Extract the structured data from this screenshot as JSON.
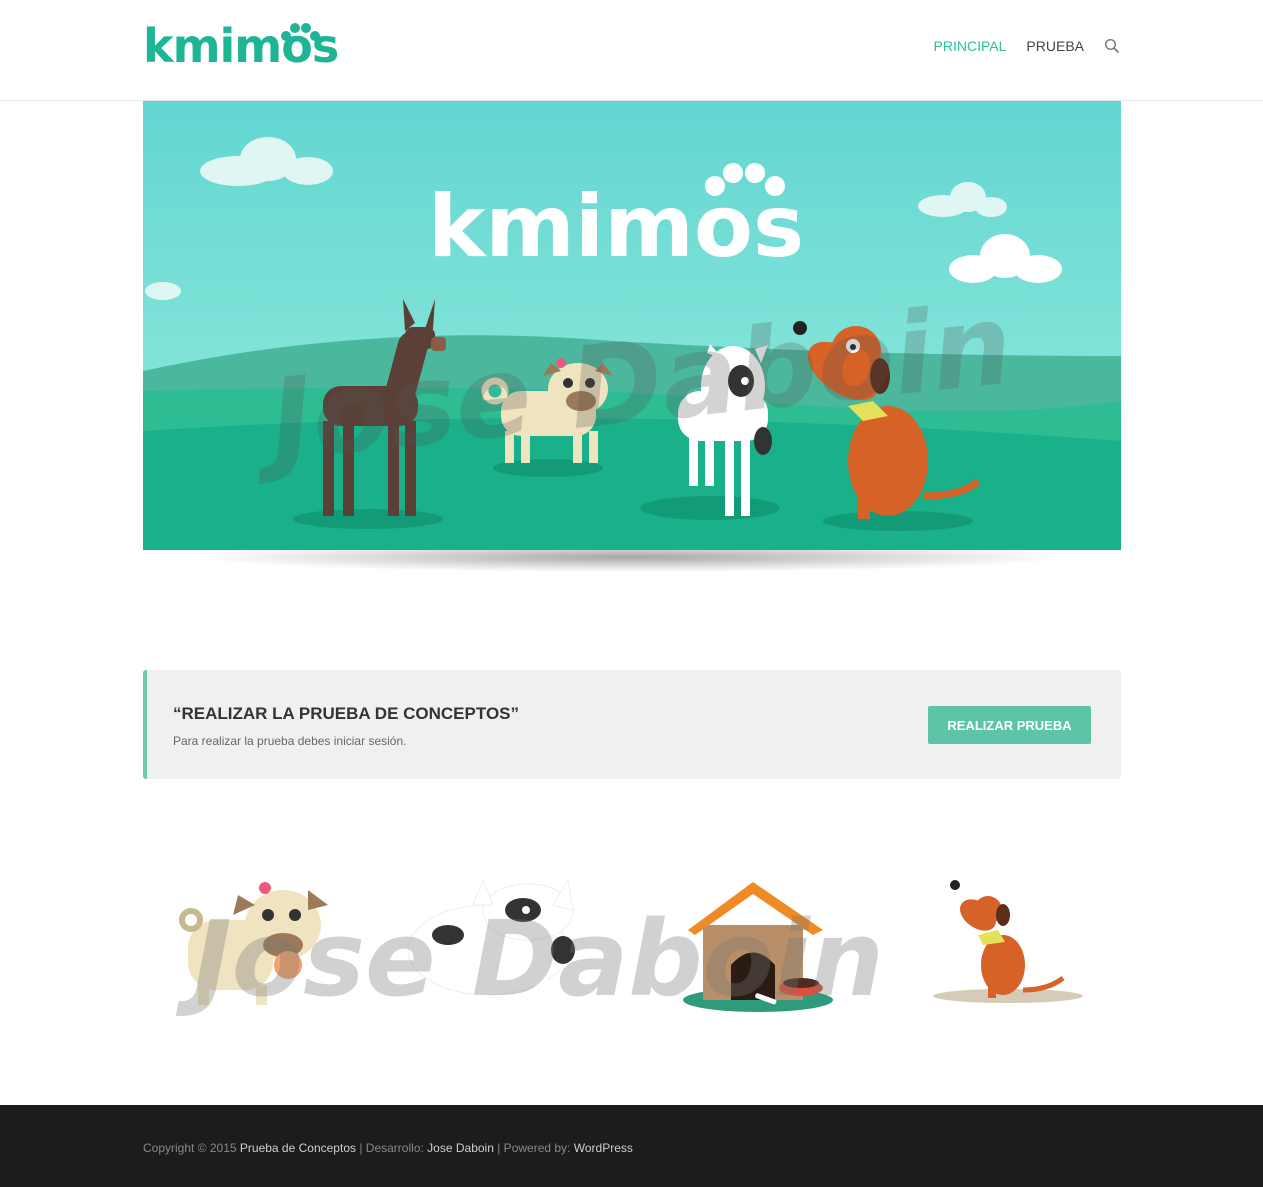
{
  "header": {
    "logo_text": "kmimos",
    "nav": [
      {
        "label": "PRINCIPAL",
        "active": true
      },
      {
        "label": "PRUEBA",
        "active": false
      }
    ],
    "search_icon": "search-icon"
  },
  "hero": {
    "logo_text": "kmimos",
    "watermark": "Jose Daboin",
    "characters": [
      "doberman",
      "pug",
      "bull-terrier",
      "dachshund"
    ]
  },
  "cta": {
    "title": "“REALIZAR LA PRUEBA DE CONCEPTOS”",
    "text": "Para realizar la prueba debes iniciar sesión.",
    "button_label": "REALIZAR PRUEBA"
  },
  "illustrations": {
    "watermark": "Jose Daboin",
    "items": [
      "pug",
      "bull-terrier",
      "dog-house",
      "dachshund"
    ]
  },
  "footer": {
    "copyright_prefix": "Copyright © 2015",
    "site_link": "Prueba de Conceptos",
    "dev_prefix": "| Desarrollo:",
    "dev_link": "Jose Daboin",
    "powered_prefix": "| Powered by:",
    "powered_link": "WordPress"
  },
  "colors": {
    "brand": "#1eb496",
    "accent": "#5ec4a7",
    "footer_bg": "#1c1c1c"
  }
}
